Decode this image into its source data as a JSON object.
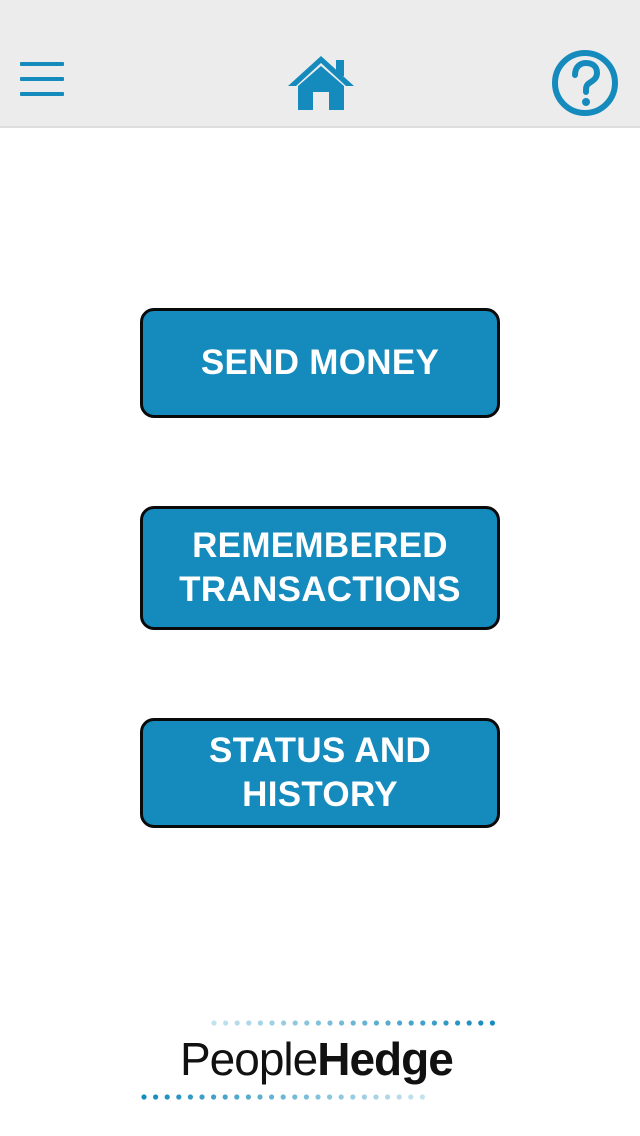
{
  "colors": {
    "topbar_bg": "#ececec",
    "icon_blue": "#158bbd",
    "button_bg": "#158bbd",
    "button_border": "#0a0a0a",
    "button_text": "#ffffff"
  },
  "header": {
    "menu_icon": "hamburger-menu-icon",
    "home_icon": "home-icon",
    "help_icon": "question-mark-circle-icon"
  },
  "main": {
    "buttons": [
      {
        "lines": [
          "SEND MONEY"
        ]
      },
      {
        "lines": [
          "REMEMBERED",
          "TRANSACTIONS"
        ]
      },
      {
        "lines": [
          "STATUS AND",
          "HISTORY"
        ]
      }
    ]
  },
  "footer": {
    "logo_regular": "People",
    "logo_bold": "Hedge"
  }
}
